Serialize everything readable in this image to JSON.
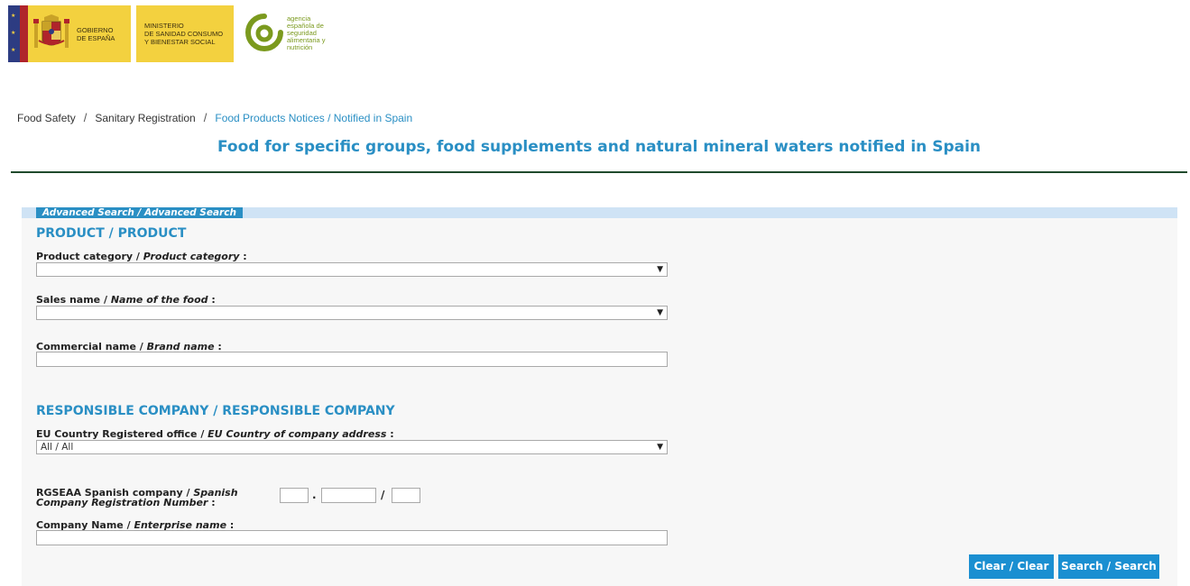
{
  "header": {
    "gov_text": "GOBIERNO\nDE ESPAÑA",
    "ministry_text": "MINISTERIO\nDE SANIDAD CONSUMO\nY BIENESTAR SOCIAL",
    "agency_text": "agencia\nespañola de\nseguridad\nalimentaria y\nnutrición"
  },
  "breadcrumb": {
    "items": [
      "Food Safety",
      "Sanitary Registration"
    ],
    "separator": "/",
    "current": "Food Products Notices / Notified in Spain"
  },
  "page_title": "Food for specific groups, food supplements and natural mineral waters notified in Spain",
  "panel": {
    "tab_label": "Advanced Search / Advanced Search",
    "product_section": {
      "title": "PRODUCT / PRODUCT",
      "category_label": "Product category / ",
      "category_label_en": "Product category",
      "category_value": "",
      "sales_label": "Sales name / ",
      "sales_label_en": "Name of the food",
      "sales_value": "",
      "commercial_label": "Commercial name / ",
      "commercial_label_en": "Brand name",
      "colon": " :"
    },
    "company_section": {
      "title": "RESPONSIBLE COMPANY / RESPONSIBLE COMPANY",
      "country_label": "EU Country Registered office / ",
      "country_label_en": "EU Country of company address",
      "country_value": "All / All",
      "rgseaa_label": "RGSEAA Spanish company / ",
      "rgseaa_label_en": "Spanish Company Registration Number",
      "rgseaa_sep1": ".",
      "rgseaa_sep2": "/",
      "company_label": "Company Name / ",
      "company_label_en": "Enterprise name"
    },
    "buttons": {
      "clear": "Clear / Clear",
      "search": "Search / Search"
    }
  },
  "colors": {
    "accent": "#2a8fc4",
    "button": "#1a8fd1",
    "panel_bg": "#f7f7f7",
    "tab_bar": "#cfe3f5",
    "gov_yellow": "#f3d13f",
    "rule": "#1f4a2c"
  }
}
